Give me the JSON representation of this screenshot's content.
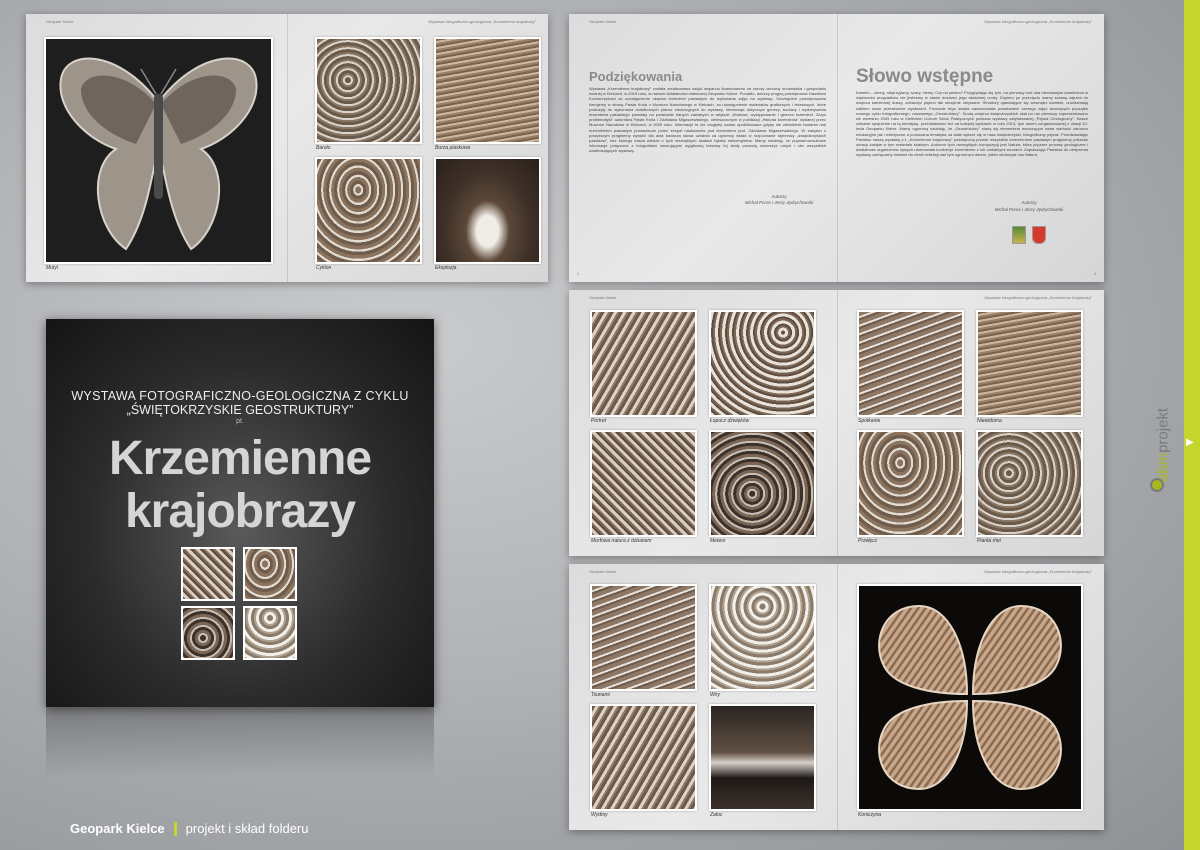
{
  "footer": {
    "client": "Geopark Kielce",
    "description": "projekt i skład folderu"
  },
  "logo": {
    "part1": "abm",
    "part2": "projekt"
  },
  "cover": {
    "subtitle_line1": "WYSTAWA FOTOGRAFICZNO-GEOLOGICZNA Z CYKLU",
    "subtitle_line2": "„ŚWIĘTOKRZYSKIE GEOSTRUKTURY”",
    "subtitle_pt": "pt.",
    "title_line1": "Krzemienne",
    "title_line2": "krajobrazy"
  },
  "spread1": {
    "header_left": "Geopark Kielce",
    "header_right": "Wystawa fotograficzno-geologiczna „Krzemienne krajobrazy”",
    "captions": [
      "Motyl",
      "Barolo",
      "Burza piaskowa",
      "Cyklon",
      "Eksplozja"
    ]
  },
  "spread2": {
    "header_left": "Geopark Kielce",
    "header_right": "Wystawa fotograficzno-geologiczna „Krzemienne krajobrazy”",
    "left_heading": "Podziękowania",
    "left_text": "Wystawa „Krzemienne krajobrazy” została zrealizowana dzięki wsparciu finansowemu na rzeczy ochrony środowiska i gospodarki wodnej w Kielcach, w 2015 roku, w ramach działalności statutowej Geoparku Kielce. Ponadto, autorzy pragną podziękować Dawidowi Kucharczykowi za udostępnienie okazów krzemieni pasiastych do wykonania zdjęć na wystawę. Szczególne podziękowania kierujemy w stronę Pawła Króla z Muzeum Narodowego w Kielcach, za udostępnienie materiałów graficznych i tekstowych, które posłużyły do wykonania dodatkowych plansz edukacyjnych do wystawy. Informacje dotyczące genezy, budowy i wydobywania krzemienia pasiastego powstały na podstawie danych zawartych w artykule „Budowa, występowanie i geneza krzemieni. Zarys problematyki” autorstwa Pawła Króla i Zdzisława Migaszewskiego, umieszczonym w publikacji „Historia krzemienia” wydanej przez Muzeum Narodowe w Kielcach, w 2009 roku. Informacje te nie mogłyby zostać opublikowane gdyby nie wieloletnie badania nad krzemieniem pasiastym prowadzone przez zespół naukowców pod kierunkiem prof. Zdzisława Migaszewskiego. W związku z powyższym pragniemy wyrazić dla acta badacza słowa uznania za ogromny wkład w rozpoznanie tajemnicy „świętokrzyskich pasiaków”, bez którego nasza wiedza o tych niezwykłych skałach byłaby niekompletna. Mamy nadzieję, że popularnonaukowe informacje połączone z fotografiami ukazującymi wyjątkową teksturę tej skały pozwolą naciesżyć umysł i oko wszystkich odwiedzających wystawę.",
    "left_sig_label": "Autorzy",
    "left_sig_names": "Michał Poros i Jerzy Jędrychowski",
    "right_heading": "Słowo wstępne",
    "right_text": "Kamień – zimny, nieprzyjazny, szary, niemy. Czy na pewno? Przyglądając się tym, na pierwszy rzut oka niecekawym kamieniom w większości przypadków nie jesteśmy w stanie dostrzec jego właściwej urody. Dopiero po przecięciu mamy szansę zajrzeć do wnętrza kamiennej duszy, zobaczyć piękno tak skrzętnie skrywane. Struktury ujawniające się wewnątrz kamieni, uruchamiają całkiem nowe przestrzenie wyobraźni. Poznanie tego świata zaowocowało powstaniem szeregu zdjęć tworzących początek nowego cyklu fotograficznego, nazwanego „Geostruktury”. Środą wnętrza świętokrzyskich skał po raz pierwszy zaprezentowano we wrześniu 2009 roku w Kieleckim Liceum Sztuk Plastycznych podczas wystawy zatytułowanej „Pejzaż Geologiczny”. Nasze ciekawe spojrzenie na tą tematykę, przedstawiono też na kolejnej wystawie w roku 2014, tym razem zorganizowanej z okazji 10-lecia Geoparku Kielce. Mamy ogromną nadzieję, że „Geostruktury” staną się elementem wnoszącym nowe wartości zarówno edukacyjne jak i estetyczne a poruszana tematyka na stałe wpisze się w nasz świętokrzyski, fotograficzny pejzaż. Przedstawiając Państwu naszą wystawę p.t. „Krzemienne krajobrazy” poświęconą przede wszystkim krzemieniom pasiastym pragniemy pokazać obrazy zaklęte w tym materiale skalnym. Autorem tych niezwykłych kompozycji jest Natura, która poprzez procesy geologiczne i działalność organizmów żywych uformowała konkrecje krzemienne z ich unikalnymi wzorami. Zapraszając Państwa do obejrzenia wystawy zachęcamy również do chwili refleksji nad tym ogromnym darem, jakim obdarzyła nas Natura.",
    "right_sig_label": "Autorzy",
    "right_sig_names": "Michał Poros i Jerzy Jędrychowski",
    "page_left": "2",
    "page_right": "3"
  },
  "spread3": {
    "header_left": "Geopark Kielce",
    "header_right": "Wystawa fotograficzno-geologiczna „Krzemienne krajobrazy”",
    "captions": [
      "Portret",
      "Łopocz dźwięków",
      "Morfowa natura z dzbanem",
      "Meteor",
      "Spotkanie",
      "Niewidoma",
      "Przełęcz",
      "Pianta rhei"
    ]
  },
  "spread4": {
    "header_left": "Geopark Kielce",
    "header_right": "Wystawa fotograficzno-geologiczna „Krzemienne krajobrazy”",
    "captions": [
      "Tsunami",
      "Wiry",
      "Wydmy",
      "Zatoc",
      "Koniczyna"
    ]
  },
  "colors": {
    "accent": "#c5d52b",
    "background": "#b1b3b6"
  }
}
